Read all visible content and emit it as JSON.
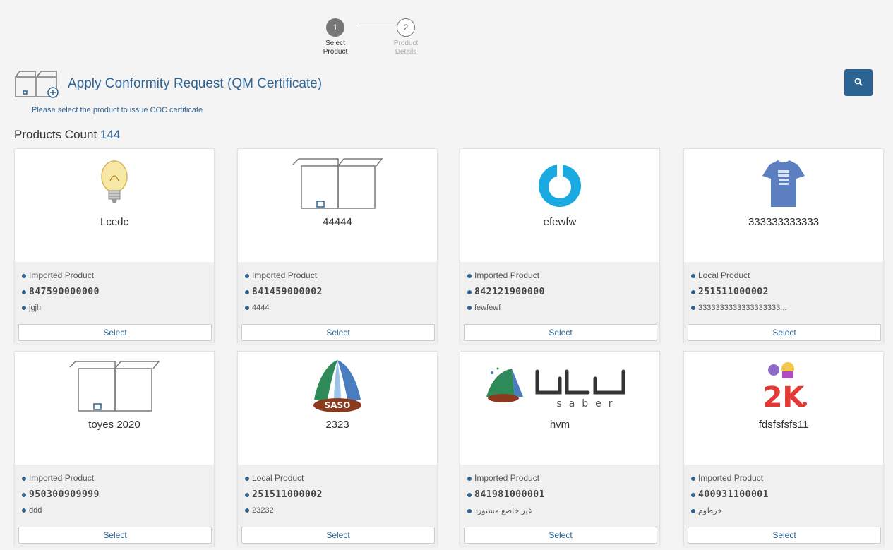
{
  "stepper": {
    "steps": [
      {
        "number": "1",
        "label_line1": "Select",
        "label_line2": "Product"
      },
      {
        "number": "2",
        "label_line1": "Product",
        "label_line2": "Details"
      }
    ]
  },
  "header": {
    "title": "Apply Conformity Request (QM Certificate)",
    "subtitle": "Please select the product to issue COC certificate",
    "count_label": "Products Count",
    "count_value": "144",
    "search_icon": "search-icon"
  },
  "colors": {
    "primary": "#2b6393",
    "link": "#2f6496"
  },
  "products": [
    {
      "name": "Lcedc",
      "image": "lightbulb",
      "type": "Imported Product",
      "code": "847590000000",
      "desc": "jgjh",
      "select": "Select"
    },
    {
      "name": "44444",
      "image": "box",
      "type": "Imported Product",
      "code": "841459000002",
      "desc": "4444",
      "select": "Select"
    },
    {
      "name": "efewfw",
      "image": "ring",
      "type": "Imported Product",
      "code": "842121900000",
      "desc": "fewfewf",
      "select": "Select"
    },
    {
      "name": "333333333333",
      "image": "tshirt",
      "type": "Local Product",
      "code": "251511000002",
      "desc": "3333333333333333333...",
      "select": "Select"
    },
    {
      "name": "toyes 2020",
      "image": "box",
      "type": "Imported Product",
      "code": "950300909999",
      "desc": "ddd",
      "select": "Select"
    },
    {
      "name": "2323",
      "image": "saso",
      "type": "Local Product",
      "code": "251511000002",
      "desc": "23232",
      "select": "Select"
    },
    {
      "name": "hvm",
      "image": "saber",
      "type": "Imported Product",
      "code": "841981000001",
      "desc": "غير خاضع مستورد",
      "select": "Select"
    },
    {
      "name": "fdsfsfsfs11",
      "image": "2k",
      "type": "Imported Product",
      "code": "400931100001",
      "desc": "خرطوم",
      "select": "Select"
    }
  ]
}
